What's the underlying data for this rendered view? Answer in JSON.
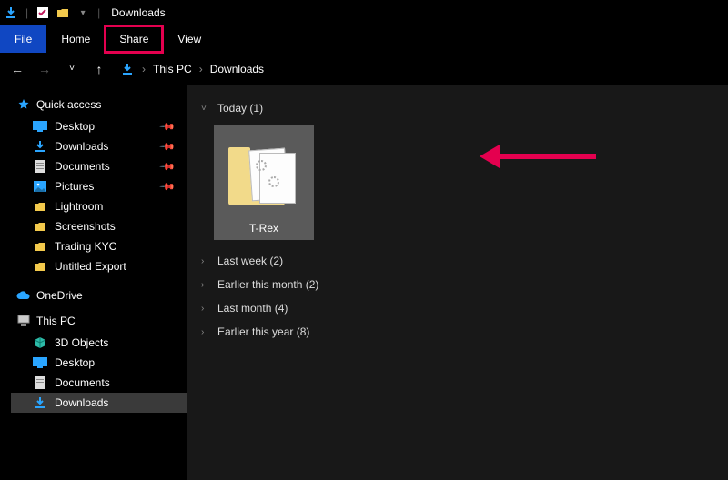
{
  "titlebar": {
    "title": "Downloads"
  },
  "ribbon": {
    "tabs": {
      "file": "File",
      "home": "Home",
      "share": "Share",
      "view": "View"
    }
  },
  "breadcrumb": {
    "this_pc": "This PC",
    "downloads": "Downloads"
  },
  "sidebar": {
    "quick_access": {
      "label": "Quick access",
      "items": [
        {
          "label": "Desktop",
          "pinned": true
        },
        {
          "label": "Downloads",
          "pinned": true
        },
        {
          "label": "Documents",
          "pinned": true
        },
        {
          "label": "Pictures",
          "pinned": true
        },
        {
          "label": "Lightroom",
          "pinned": false
        },
        {
          "label": "Screenshots",
          "pinned": false
        },
        {
          "label": "Trading KYC",
          "pinned": false
        },
        {
          "label": "Untitled Export",
          "pinned": false
        }
      ]
    },
    "onedrive": {
      "label": "OneDrive"
    },
    "this_pc": {
      "label": "This PC",
      "items": [
        {
          "label": "3D Objects"
        },
        {
          "label": "Desktop"
        },
        {
          "label": "Documents"
        },
        {
          "label": "Downloads",
          "selected": true
        }
      ]
    }
  },
  "content": {
    "groups": [
      {
        "label": "Today",
        "count": 1,
        "expanded": true
      },
      {
        "label": "Last week",
        "count": 2,
        "expanded": false
      },
      {
        "label": "Earlier this month",
        "count": 2,
        "expanded": false
      },
      {
        "label": "Last month",
        "count": 4,
        "expanded": false
      },
      {
        "label": "Earlier this year",
        "count": 8,
        "expanded": false
      }
    ],
    "item": {
      "name": "T-Rex"
    }
  }
}
